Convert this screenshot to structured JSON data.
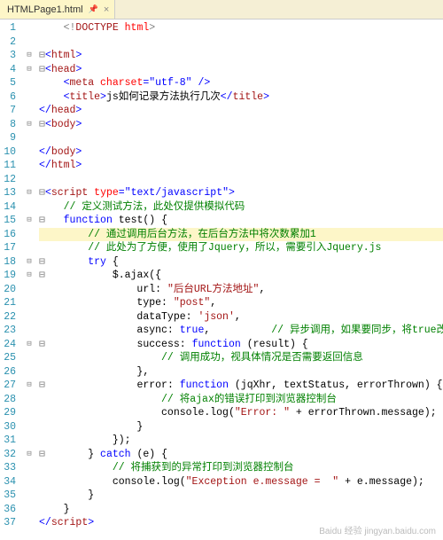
{
  "tab": {
    "name": "HTMLPage1.html",
    "pin_glyph": "📌",
    "close_glyph": "×"
  },
  "fold": {
    "1": "",
    "2": "",
    "3": "⊟",
    "4": "⊟",
    "5": "",
    "6": "",
    "7": "",
    "8": "⊟",
    "9": "",
    "10": "",
    "11": "",
    "12": "",
    "13": "⊟",
    "14": "",
    "15": "⊟",
    "16": "",
    "17": "",
    "18": "⊟",
    "19": "⊟",
    "20": "",
    "21": "",
    "22": "",
    "23": "",
    "24": "⊟",
    "25": "",
    "26": "",
    "27": "⊟",
    "28": "",
    "29": "",
    "30": "",
    "31": "",
    "32": "⊟",
    "33": "",
    "34": "",
    "35": "",
    "36": "",
    "37": ""
  },
  "code": {
    "1": {
      "indent": "    ",
      "tokens": [
        [
          "<!",
          "gray"
        ],
        [
          "DOCTYPE",
          "brown"
        ],
        [
          " ",
          "black"
        ],
        [
          "html",
          "red"
        ],
        [
          ">",
          "gray"
        ]
      ]
    },
    "2": {
      "indent": "",
      "tokens": []
    },
    "3": {
      "indent": "",
      "tokens": [
        [
          "⊟",
          "gray"
        ],
        [
          "<",
          "blue"
        ],
        [
          "html",
          "brown"
        ],
        [
          ">",
          "blue"
        ]
      ]
    },
    "4": {
      "indent": "",
      "tokens": [
        [
          "⊟",
          "gray"
        ],
        [
          "<",
          "blue"
        ],
        [
          "head",
          "brown"
        ],
        [
          ">",
          "blue"
        ]
      ]
    },
    "5": {
      "indent": "    ",
      "tokens": [
        [
          "<",
          "blue"
        ],
        [
          "meta",
          "brown"
        ],
        [
          " ",
          "black"
        ],
        [
          "charset",
          "red"
        ],
        [
          "=",
          "blue"
        ],
        [
          "\"utf-8\"",
          "blue"
        ],
        [
          " />",
          "blue"
        ]
      ]
    },
    "6": {
      "indent": "    ",
      "tokens": [
        [
          "<",
          "blue"
        ],
        [
          "title",
          "brown"
        ],
        [
          ">",
          "blue"
        ],
        [
          "js如何记录方法执行几次",
          "black"
        ],
        [
          "</",
          "blue"
        ],
        [
          "title",
          "brown"
        ],
        [
          ">",
          "blue"
        ]
      ]
    },
    "7": {
      "indent": "",
      "tokens": [
        [
          "</",
          "blue"
        ],
        [
          "head",
          "brown"
        ],
        [
          ">",
          "blue"
        ]
      ]
    },
    "8": {
      "indent": "",
      "tokens": [
        [
          "⊟",
          "gray"
        ],
        [
          "<",
          "blue"
        ],
        [
          "body",
          "brown"
        ],
        [
          ">",
          "blue"
        ]
      ]
    },
    "9": {
      "indent": "",
      "tokens": []
    },
    "10": {
      "indent": "",
      "tokens": [
        [
          "</",
          "blue"
        ],
        [
          "body",
          "brown"
        ],
        [
          ">",
          "blue"
        ]
      ]
    },
    "11": {
      "indent": "",
      "tokens": [
        [
          "</",
          "blue"
        ],
        [
          "html",
          "brown"
        ],
        [
          ">",
          "blue"
        ]
      ]
    },
    "12": {
      "indent": "",
      "tokens": []
    },
    "13": {
      "indent": "",
      "tokens": [
        [
          "⊟",
          "gray"
        ],
        [
          "<",
          "blue"
        ],
        [
          "script",
          "brown"
        ],
        [
          " ",
          "black"
        ],
        [
          "type",
          "red"
        ],
        [
          "=",
          "blue"
        ],
        [
          "\"text/javascript\"",
          "blue"
        ],
        [
          ">",
          "blue"
        ]
      ]
    },
    "14": {
      "indent": "    ",
      "tokens": [
        [
          "// 定义测试方法，此处仅提供模拟代码",
          "green"
        ]
      ]
    },
    "15": {
      "indent": "",
      "tokens": [
        [
          "⊟   ",
          "gray"
        ],
        [
          "function",
          "blue"
        ],
        [
          " test() {",
          "black"
        ]
      ]
    },
    "16": {
      "indent": "        ",
      "hl": true,
      "tokens": [
        [
          "// 通过调用后台方法，在后台方法中将次数累加1",
          "green"
        ]
      ]
    },
    "17": {
      "indent": "        ",
      "tokens": [
        [
          "// 此处为了方便，使用了Jquery，所以，需要引入Jquery.js",
          "green"
        ]
      ]
    },
    "18": {
      "indent": "",
      "tokens": [
        [
          "⊟       ",
          "gray"
        ],
        [
          "try",
          "blue"
        ],
        [
          " {",
          "black"
        ]
      ]
    },
    "19": {
      "indent": "",
      "tokens": [
        [
          "⊟           ",
          "gray"
        ],
        [
          "$.ajax({",
          "black"
        ]
      ]
    },
    "20": {
      "indent": "                ",
      "tokens": [
        [
          "url: ",
          "black"
        ],
        [
          "\"后台URL方法地址\"",
          "brown"
        ],
        [
          ",",
          "black"
        ]
      ]
    },
    "21": {
      "indent": "                ",
      "tokens": [
        [
          "type: ",
          "black"
        ],
        [
          "\"post\"",
          "brown"
        ],
        [
          ",",
          "black"
        ]
      ]
    },
    "22": {
      "indent": "                ",
      "tokens": [
        [
          "dataType: ",
          "black"
        ],
        [
          "'json'",
          "brown"
        ],
        [
          ",",
          "black"
        ]
      ]
    },
    "23": {
      "indent": "                ",
      "tokens": [
        [
          "async: ",
          "black"
        ],
        [
          "true",
          "blue"
        ],
        [
          ",          ",
          "black"
        ],
        [
          "// 异步调用，如果要同步，将true改为false即可",
          "green"
        ]
      ]
    },
    "24": {
      "indent": "",
      "tokens": [
        [
          "⊟               ",
          "gray"
        ],
        [
          "success: ",
          "black"
        ],
        [
          "function",
          "blue"
        ],
        [
          " (result) {",
          "black"
        ]
      ]
    },
    "25": {
      "indent": "                    ",
      "tokens": [
        [
          "// 调用成功，视具体情况是否需要返回信息",
          "green"
        ]
      ]
    },
    "26": {
      "indent": "                ",
      "tokens": [
        [
          "},",
          "black"
        ]
      ]
    },
    "27": {
      "indent": "",
      "tokens": [
        [
          "⊟               ",
          "gray"
        ],
        [
          "error: ",
          "black"
        ],
        [
          "function",
          "blue"
        ],
        [
          " (jqXhr, textStatus, errorThrown) {",
          "black"
        ]
      ]
    },
    "28": {
      "indent": "                    ",
      "tokens": [
        [
          "// 将ajax的错误打印到浏览器控制台",
          "green"
        ]
      ]
    },
    "29": {
      "indent": "                    ",
      "tokens": [
        [
          "console.log(",
          "black"
        ],
        [
          "\"Error: \"",
          "brown"
        ],
        [
          " + errorThrown.message);",
          "black"
        ]
      ]
    },
    "30": {
      "indent": "                ",
      "tokens": [
        [
          "}",
          "black"
        ]
      ]
    },
    "31": {
      "indent": "            ",
      "tokens": [
        [
          "});",
          "black"
        ]
      ]
    },
    "32": {
      "indent": "",
      "tokens": [
        [
          "⊟       ",
          "gray"
        ],
        [
          "} ",
          "black"
        ],
        [
          "catch",
          "blue"
        ],
        [
          " (e) {",
          "black"
        ]
      ]
    },
    "33": {
      "indent": "            ",
      "tokens": [
        [
          "// 将捕获到的异常打印到浏览器控制台",
          "green"
        ]
      ]
    },
    "34": {
      "indent": "            ",
      "tokens": [
        [
          "console.log(",
          "black"
        ],
        [
          "\"Exception e.message =  \"",
          "brown"
        ],
        [
          " + e.message);",
          "black"
        ]
      ]
    },
    "35": {
      "indent": "        ",
      "tokens": [
        [
          "}",
          "black"
        ]
      ]
    },
    "36": {
      "indent": "    ",
      "tokens": [
        [
          "}",
          "black"
        ]
      ]
    },
    "37": {
      "indent": "",
      "tokens": [
        [
          "</",
          "blue"
        ],
        [
          "script",
          "brown"
        ],
        [
          ">",
          "blue"
        ]
      ]
    }
  },
  "watermark": "Baidu 经验  jingyan.baidu.com"
}
